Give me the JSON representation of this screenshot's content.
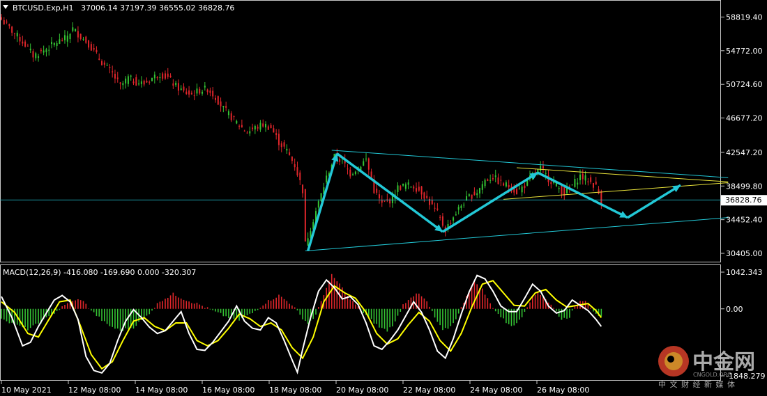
{
  "main_header": {
    "symbol": "BTCUSD.Exp,H1",
    "ohlc": "37006.14 37197.39 36555.02 36828.76"
  },
  "macd_header": {
    "label": "MACD(12,26,9) -416.080 -169.690 0.000 -320.307"
  },
  "price_axis": {
    "ticks": [
      "58819.40",
      "54772.00",
      "50724.60",
      "46677.20",
      "42547.20",
      "38499.80",
      "34452.40",
      "30405.00"
    ],
    "current_price": "36828.76"
  },
  "macd_axis": {
    "ticks": [
      "1042.343",
      "0.00",
      "-1848.279"
    ]
  },
  "time_axis": {
    "ticks": [
      "10 May 2021",
      "12 May 08:00",
      "14 May 08:00",
      "16 May 08:00",
      "18 May 08:00",
      "20 May 08:00",
      "22 May 08:00",
      "24 May 08:00",
      "26 May 08:00"
    ]
  },
  "watermark": {
    "brand": "中金网",
    "latin": "CNGOLD.ORG",
    "slogan": "中 文 财 经 新 媒 体"
  },
  "colors": {
    "bg": "#000000",
    "bull": "#35c434",
    "bear": "#e0262b",
    "trend": "#22c8d6",
    "yellow": "#e8e23a",
    "macd_line": "#ffffff",
    "signal_line": "#ffff00",
    "grid_text": "#ffffff"
  },
  "chart_data": {
    "type": "candlestick",
    "symbol": "BTCUSD",
    "timeframe": "H1",
    "ylim": [
      29400,
      60700
    ],
    "path": [
      [
        0,
        58500
      ],
      [
        3,
        57500
      ],
      [
        6,
        56500
      ],
      [
        9,
        55500
      ],
      [
        12,
        54200
      ],
      [
        15,
        54600
      ],
      [
        18,
        55200
      ],
      [
        21,
        55800
      ],
      [
        24,
        56200
      ],
      [
        27,
        57400
      ],
      [
        30,
        56500
      ],
      [
        33,
        55600
      ],
      [
        36,
        54200
      ],
      [
        39,
        53000
      ],
      [
        42,
        52000
      ],
      [
        45,
        50500
      ],
      [
        48,
        51500
      ],
      [
        51,
        51000
      ],
      [
        54,
        50800
      ],
      [
        57,
        51500
      ],
      [
        60,
        52000
      ],
      [
        63,
        51500
      ],
      [
        66,
        50500
      ],
      [
        69,
        49800
      ],
      [
        72,
        49500
      ],
      [
        75,
        50000
      ],
      [
        78,
        50200
      ],
      [
        81,
        49200
      ],
      [
        84,
        47800
      ],
      [
        87,
        46800
      ],
      [
        90,
        45800
      ],
      [
        93,
        45000
      ],
      [
        96,
        45500
      ],
      [
        99,
        45900
      ],
      [
        102,
        45500
      ],
      [
        105,
        43800
      ],
      [
        108,
        42700
      ],
      [
        111,
        41000
      ],
      [
        114,
        38000
      ],
      [
        115,
        31500
      ],
      [
        117,
        33500
      ],
      [
        120,
        36500
      ],
      [
        123,
        39500
      ],
      [
        126,
        42000
      ],
      [
        129,
        41500
      ],
      [
        132,
        40000
      ],
      [
        135,
        40800
      ],
      [
        138,
        41700
      ],
      [
        141,
        38000
      ],
      [
        144,
        36300
      ],
      [
        147,
        36800
      ],
      [
        150,
        38300
      ],
      [
        153,
        38600
      ],
      [
        156,
        38500
      ],
      [
        159,
        37800
      ],
      [
        162,
        36500
      ],
      [
        165,
        35200
      ],
      [
        168,
        33200
      ],
      [
        171,
        34800
      ],
      [
        174,
        36200
      ],
      [
        177,
        37200
      ],
      [
        180,
        37800
      ],
      [
        183,
        39200
      ],
      [
        186,
        39600
      ],
      [
        189,
        38800
      ],
      [
        192,
        38500
      ],
      [
        195,
        37800
      ],
      [
        198,
        38600
      ],
      [
        201,
        39800
      ],
      [
        204,
        40600
      ],
      [
        207,
        39400
      ],
      [
        210,
        38600
      ],
      [
        213,
        37600
      ],
      [
        216,
        38600
      ],
      [
        219,
        39700
      ],
      [
        222,
        39200
      ],
      [
        225,
        38400
      ],
      [
        227,
        36800
      ]
    ],
    "annotations": {
      "triangle_upper": [
        [
          125,
          42800
        ],
        [
          275,
          39500
        ]
      ],
      "triangle_lower": [
        [
          115,
          30700
        ],
        [
          275,
          34700
        ]
      ],
      "yellow_upper": [
        [
          195,
          40700
        ],
        [
          275,
          39000
        ]
      ],
      "yellow_lower": [
        [
          190,
          36900
        ],
        [
          275,
          38900
        ]
      ],
      "arrows": [
        [
          116,
          30700
        ],
        [
          127,
          42400
        ],
        [
          167,
          33000
        ],
        [
          203,
          40100
        ],
        [
          237,
          34700
        ],
        [
          257,
          38600
        ]
      ]
    },
    "macd": {
      "ylim": [
        -2000,
        1200
      ],
      "histogram": [
        [
          0,
          -250
        ],
        [
          5,
          -450
        ],
        [
          10,
          -580
        ],
        [
          15,
          -380
        ],
        [
          20,
          -120
        ],
        [
          25,
          150
        ],
        [
          30,
          280
        ],
        [
          35,
          -120
        ],
        [
          40,
          -450
        ],
        [
          45,
          -620
        ],
        [
          50,
          -520
        ],
        [
          55,
          -200
        ],
        [
          60,
          220
        ],
        [
          65,
          420
        ],
        [
          70,
          250
        ],
        [
          75,
          120
        ],
        [
          80,
          -60
        ],
        [
          85,
          -220
        ],
        [
          90,
          -320
        ],
        [
          95,
          -120
        ],
        [
          100,
          180
        ],
        [
          105,
          380
        ],
        [
          110,
          120
        ],
        [
          113,
          -180
        ],
        [
          116,
          -420
        ],
        [
          119,
          -180
        ],
        [
          122,
          420
        ],
        [
          125,
          950
        ],
        [
          128,
          700
        ],
        [
          131,
          350
        ],
        [
          134,
          120
        ],
        [
          137,
          -120
        ],
        [
          140,
          -320
        ],
        [
          143,
          -520
        ],
        [
          146,
          -620
        ],
        [
          149,
          -380
        ],
        [
          152,
          120
        ],
        [
          155,
          350
        ],
        [
          158,
          420
        ],
        [
          161,
          200
        ],
        [
          164,
          -250
        ],
        [
          167,
          -620
        ],
        [
          170,
          -500
        ],
        [
          173,
          -150
        ],
        [
          176,
          380
        ],
        [
          179,
          780
        ],
        [
          182,
          550
        ],
        [
          185,
          150
        ],
        [
          188,
          -150
        ],
        [
          191,
          -380
        ],
        [
          194,
          -500
        ],
        [
          197,
          -200
        ],
        [
          200,
          220
        ],
        [
          203,
          480
        ],
        [
          206,
          280
        ],
        [
          209,
          20
        ],
        [
          212,
          -300
        ],
        [
          215,
          -220
        ],
        [
          218,
          200
        ],
        [
          221,
          260
        ],
        [
          224,
          -50
        ],
        [
          227,
          -250
        ]
      ],
      "macd_line": [
        [
          0,
          350
        ],
        [
          4,
          -250
        ],
        [
          8,
          -1050
        ],
        [
          11,
          -950
        ],
        [
          14,
          -500
        ],
        [
          17,
          -120
        ],
        [
          20,
          250
        ],
        [
          23,
          380
        ],
        [
          26,
          200
        ],
        [
          29,
          -300
        ],
        [
          32,
          -1350
        ],
        [
          35,
          -1750
        ],
        [
          38,
          -1820
        ],
        [
          41,
          -1550
        ],
        [
          44,
          -900
        ],
        [
          47,
          -350
        ],
        [
          50,
          -20
        ],
        [
          53,
          -250
        ],
        [
          56,
          -520
        ],
        [
          59,
          -700
        ],
        [
          62,
          -620
        ],
        [
          65,
          -350
        ],
        [
          68,
          -80
        ],
        [
          71,
          -700
        ],
        [
          74,
          -1150
        ],
        [
          77,
          -1180
        ],
        [
          80,
          -950
        ],
        [
          83,
          -650
        ],
        [
          86,
          -350
        ],
        [
          89,
          80
        ],
        [
          92,
          -350
        ],
        [
          95,
          -550
        ],
        [
          98,
          -600
        ],
        [
          101,
          -250
        ],
        [
          104,
          -400
        ],
        [
          107,
          -900
        ],
        [
          110,
          -1450
        ],
        [
          112,
          -1800
        ],
        [
          114,
          -1150
        ],
        [
          117,
          -250
        ],
        [
          120,
          500
        ],
        [
          123,
          820
        ],
        [
          126,
          600
        ],
        [
          129,
          280
        ],
        [
          132,
          350
        ],
        [
          135,
          120
        ],
        [
          138,
          -400
        ],
        [
          141,
          -1050
        ],
        [
          144,
          -1150
        ],
        [
          147,
          -900
        ],
        [
          150,
          -600
        ],
        [
          153,
          -200
        ],
        [
          156,
          200
        ],
        [
          159,
          -100
        ],
        [
          162,
          -600
        ],
        [
          165,
          -1200
        ],
        [
          168,
          -1400
        ],
        [
          171,
          -850
        ],
        [
          174,
          -150
        ],
        [
          177,
          480
        ],
        [
          180,
          950
        ],
        [
          183,
          850
        ],
        [
          186,
          500
        ],
        [
          189,
          80
        ],
        [
          192,
          -80
        ],
        [
          195,
          -80
        ],
        [
          198,
          300
        ],
        [
          201,
          700
        ],
        [
          204,
          500
        ],
        [
          207,
          80
        ],
        [
          210,
          -120
        ],
        [
          213,
          -50
        ],
        [
          216,
          250
        ],
        [
          219,
          100
        ],
        [
          222,
          -50
        ],
        [
          225,
          -300
        ],
        [
          227,
          -500
        ]
      ],
      "signal_line": [
        [
          0,
          200
        ],
        [
          5,
          -100
        ],
        [
          10,
          -700
        ],
        [
          14,
          -800
        ],
        [
          18,
          -300
        ],
        [
          22,
          200
        ],
        [
          26,
          250
        ],
        [
          30,
          -500
        ],
        [
          34,
          -1300
        ],
        [
          38,
          -1700
        ],
        [
          42,
          -1500
        ],
        [
          46,
          -900
        ],
        [
          50,
          -350
        ],
        [
          54,
          -250
        ],
        [
          58,
          -500
        ],
        [
          62,
          -620
        ],
        [
          66,
          -400
        ],
        [
          70,
          -400
        ],
        [
          74,
          -900
        ],
        [
          78,
          -1050
        ],
        [
          82,
          -900
        ],
        [
          86,
          -550
        ],
        [
          90,
          -150
        ],
        [
          94,
          -280
        ],
        [
          98,
          -500
        ],
        [
          102,
          -400
        ],
        [
          106,
          -600
        ],
        [
          110,
          -1100
        ],
        [
          114,
          -1400
        ],
        [
          118,
          -800
        ],
        [
          122,
          200
        ],
        [
          126,
          650
        ],
        [
          130,
          450
        ],
        [
          134,
          300
        ],
        [
          138,
          -100
        ],
        [
          142,
          -700
        ],
        [
          146,
          -1000
        ],
        [
          150,
          -850
        ],
        [
          154,
          -450
        ],
        [
          158,
          -100
        ],
        [
          162,
          -350
        ],
        [
          166,
          -900
        ],
        [
          170,
          -1200
        ],
        [
          174,
          -700
        ],
        [
          178,
          50
        ],
        [
          182,
          700
        ],
        [
          186,
          800
        ],
        [
          190,
          450
        ],
        [
          194,
          100
        ],
        [
          198,
          80
        ],
        [
          202,
          450
        ],
        [
          206,
          550
        ],
        [
          210,
          250
        ],
        [
          214,
          50
        ],
        [
          218,
          100
        ],
        [
          222,
          150
        ],
        [
          225,
          -50
        ],
        [
          227,
          -250
        ]
      ]
    }
  }
}
